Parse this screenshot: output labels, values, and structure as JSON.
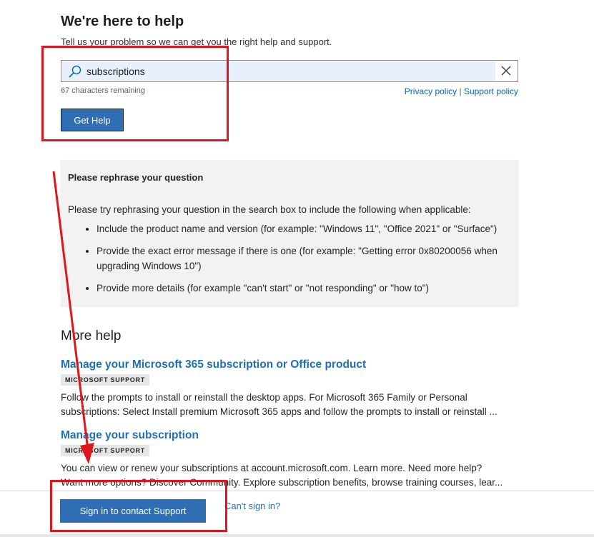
{
  "header": {
    "title": "We're here to help",
    "subtitle": "Tell us your problem so we can get you the right help and support."
  },
  "search": {
    "value": "subscriptions",
    "placeholder": "",
    "chars_remaining": "67 characters remaining",
    "icons": {
      "search": "search-icon",
      "clear": "close-icon"
    }
  },
  "policy": {
    "privacy": "Privacy policy",
    "separator": "|",
    "support": "Support policy"
  },
  "get_help_label": "Get Help",
  "rephrase": {
    "title": "Please rephrase your question",
    "intro": "Please try rephrasing your question in the search box to include the following when applicable:",
    "items": [
      "Include the product name and version (for example: \"Windows 11\", \"Office 2021\" or \"Surface\")",
      "Provide the exact error message if there is one (for example: \"Getting error 0x80200056 when upgrading Windows 10\")",
      "Provide more details (for example \"can't start\" or \"not responding\" or \"how to\")"
    ]
  },
  "more_help": {
    "heading": "More help",
    "results": [
      {
        "title": "Manage your Microsoft 365 subscription or Office product",
        "badge": "MICROSOFT SUPPORT",
        "desc_line1": "Follow the prompts to install or reinstall the desktop apps. For Microsoft 365 Family or Personal",
        "desc_line2": "subscriptions: Select Install premium Microsoft 365 apps and follow the prompts to install or reinstall ..."
      },
      {
        "title": "Manage your subscription",
        "badge": "MICROSOFT SUPPORT",
        "desc_line1": "You can view or renew your subscriptions at account.microsoft.com. Learn more. Need more help?",
        "desc_line2": "Want more options? Discover Community. Explore subscription benefits, browse training courses, lear..."
      }
    ]
  },
  "footer": {
    "sign_in_label": "Sign in to contact Support",
    "cant_sign_in": "Can't sign in?"
  },
  "colors": {
    "accent": "#2f6eb3",
    "link": "#1f6fb2",
    "annotation": "#e0161c",
    "panel": "#f2f2f2"
  }
}
